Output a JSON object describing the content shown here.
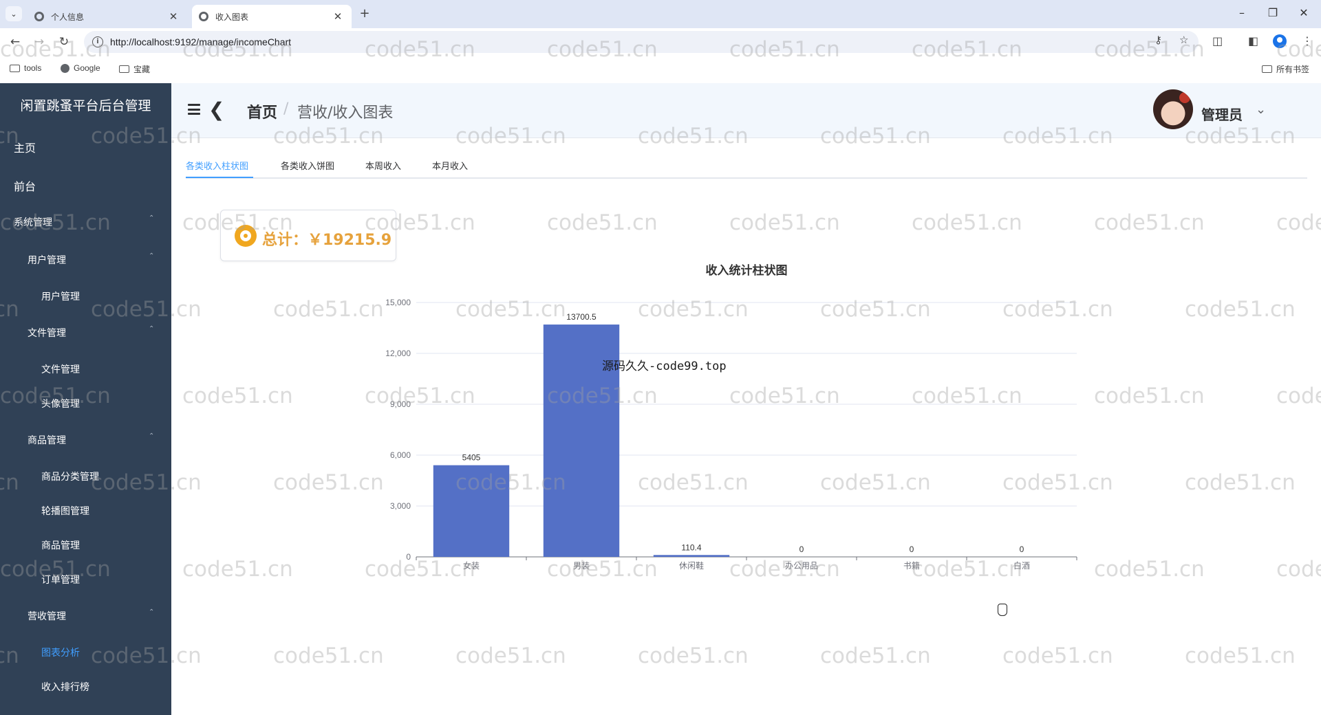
{
  "browser": {
    "tabs": [
      {
        "title": "个人信息",
        "active": false
      },
      {
        "title": "收入图表",
        "active": true
      }
    ],
    "url": "http://localhost:9192/manage/incomeChart",
    "bookmarks": [
      "tools",
      "Google",
      "宝藏"
    ],
    "all_bookmarks_label": "所有书签"
  },
  "sidebar": {
    "title": "闲置跳蚤平台后台管理",
    "items": [
      {
        "label": "主页",
        "level": 0
      },
      {
        "label": "前台",
        "level": 0
      },
      {
        "label": "系统管理",
        "level": 1,
        "expanded": true
      },
      {
        "label": "用户管理",
        "level": 2,
        "expanded": true
      },
      {
        "label": "用户管理",
        "level": 3
      },
      {
        "label": "文件管理",
        "level": 2,
        "expanded": true
      },
      {
        "label": "文件管理",
        "level": 3
      },
      {
        "label": "头像管理",
        "level": 3
      },
      {
        "label": "商品管理",
        "level": 2,
        "expanded": true
      },
      {
        "label": "商品分类管理",
        "level": 3
      },
      {
        "label": "轮播图管理",
        "level": 3
      },
      {
        "label": "商品管理",
        "level": 3
      },
      {
        "label": "订单管理",
        "level": 3
      },
      {
        "label": "营收管理",
        "level": 2,
        "expanded": true
      },
      {
        "label": "图表分析",
        "level": 3,
        "active": true
      },
      {
        "label": "收入排行榜",
        "level": 3
      }
    ]
  },
  "header": {
    "breadcrumb_home": "首页",
    "breadcrumb_sep": "/",
    "breadcrumb_current": "营收/收入图表",
    "user_name": "管理员"
  },
  "tabs": [
    {
      "label": "各类收入柱状图",
      "active": true
    },
    {
      "label": "各类收入饼图",
      "active": false
    },
    {
      "label": "本周收入",
      "active": false
    },
    {
      "label": "本月收入",
      "active": false
    }
  ],
  "total": {
    "label": "总计：￥19215.9"
  },
  "watermark": {
    "text": "code51.cn",
    "center_text": "源码久久-code99.top"
  },
  "colors": {
    "bar": "#5470c6",
    "sidebar_bg": "#304156",
    "accent": "#409eff",
    "total": "#e6a23c"
  },
  "chart_data": {
    "type": "bar",
    "title": "收入统计柱状图",
    "categories": [
      "女装",
      "男装",
      "休闲鞋",
      "办公用品",
      "书籍",
      "白酒"
    ],
    "values": [
      5405,
      13700.5,
      110.4,
      0,
      0,
      0
    ],
    "value_labels": [
      "5405",
      "13700.5",
      "110.4",
      "0",
      "0",
      "0"
    ],
    "y_ticks": [
      "0",
      "3,000",
      "6,000",
      "9,000",
      "12,000",
      "15,000"
    ],
    "ylim": [
      0,
      15000
    ],
    "xlabel": "",
    "ylabel": "",
    "grid": true,
    "legend": false
  }
}
